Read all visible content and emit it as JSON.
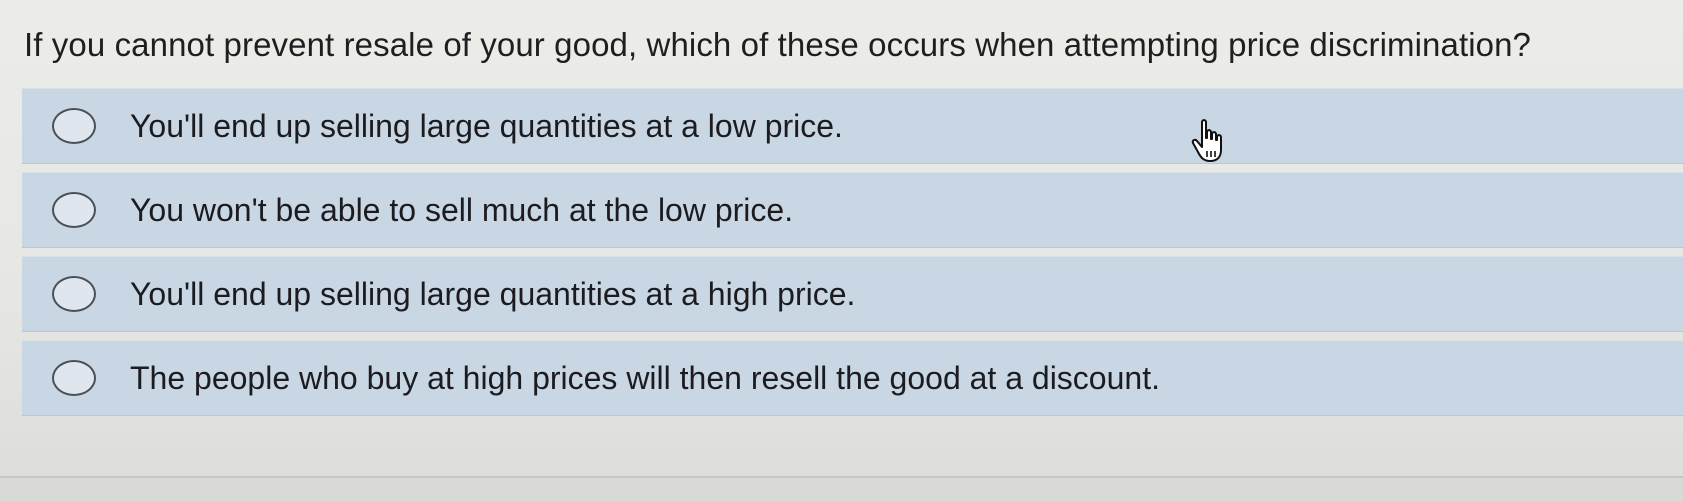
{
  "question": {
    "text": "If you cannot prevent resale of your good, which of these occurs when attempting price discrimination?"
  },
  "options": [
    {
      "label": "You'll end up selling large quantities at a low price.",
      "selected": false
    },
    {
      "label": "You won't be able to sell much at the low price.",
      "selected": false
    },
    {
      "label": "You'll end up selling large quantities at a high price.",
      "selected": false
    },
    {
      "label": "The people who buy at high prices will then resell the good at a discount.",
      "selected": false
    }
  ],
  "colors": {
    "option_background": "#c9d6e3",
    "page_background": "#e6e6e2",
    "text": "#1f1f22"
  },
  "icons": {
    "cursor": "hand-pointer-cursor-icon",
    "radio": "radio-unselected-icon"
  }
}
